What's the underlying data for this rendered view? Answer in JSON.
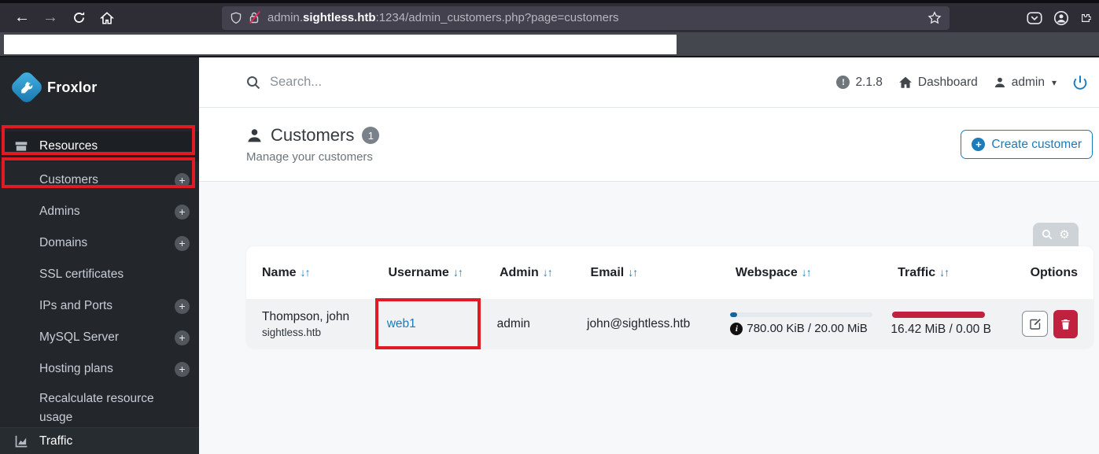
{
  "browser": {
    "url_subdomain": "admin.",
    "url_domain": "sightless.htb",
    "url_path": ":1234/admin_customers.php?page=customers"
  },
  "sidebar": {
    "brand": "Froxlor",
    "items": [
      {
        "label": "Resources"
      },
      {
        "label": "Customers"
      },
      {
        "label": "Admins"
      },
      {
        "label": "Domains"
      },
      {
        "label": "SSL certificates"
      },
      {
        "label": "IPs and Ports"
      },
      {
        "label": "MySQL Server"
      },
      {
        "label": "Hosting plans"
      },
      {
        "label": "Recalculate resource usage"
      },
      {
        "label": "Traffic"
      }
    ],
    "plus_glyph": "+"
  },
  "topbar": {
    "search_placeholder": "Search...",
    "version": "2.1.8",
    "version_icon_glyph": "!",
    "dashboard_label": "Dashboard",
    "user_label": "admin"
  },
  "page": {
    "title": "Customers",
    "count_badge": "1",
    "subtitle": "Manage your customers",
    "create_button_label": "Create customer",
    "create_plus_glyph": "+"
  },
  "table": {
    "sort_glyph": "↓↑",
    "headers": [
      "Name",
      "Username",
      "Admin",
      "Email",
      "Webspace",
      "Traffic",
      "Options"
    ],
    "row": {
      "name": "Thompson, john",
      "name_sub": "sightless.htb",
      "username": "web1",
      "admin": "admin",
      "email": "john@sightless.htb",
      "webspace_usage": "780.00 KiB / 20.00 MiB",
      "webspace_info_glyph": "i",
      "traffic_usage": "16.42 MiB / 0.00 B"
    }
  },
  "colors": {
    "accent_blue": "#1a7cb8",
    "danger_crimson": "#c2203f",
    "annotation_red": "#e01b24"
  }
}
